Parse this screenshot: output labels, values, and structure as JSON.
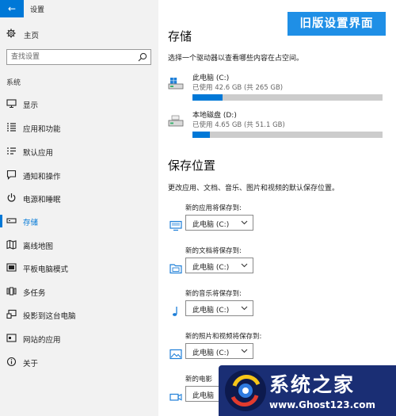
{
  "window": {
    "title": "设置",
    "back_glyph": "←"
  },
  "sidebar": {
    "home_label": "主页",
    "search_placeholder": "查找设置",
    "section_label": "系统",
    "items": [
      {
        "label": "显示",
        "icon": "display-icon"
      },
      {
        "label": "应用和功能",
        "icon": "apps-list-icon"
      },
      {
        "label": "默认应用",
        "icon": "default-apps-icon"
      },
      {
        "label": "通知和操作",
        "icon": "notification-icon"
      },
      {
        "label": "电源和睡眠",
        "icon": "power-icon"
      },
      {
        "label": "存储",
        "icon": "storage-icon",
        "active": true
      },
      {
        "label": "离线地图",
        "icon": "map-icon"
      },
      {
        "label": "平板电脑模式",
        "icon": "tablet-icon"
      },
      {
        "label": "多任务",
        "icon": "multitask-icon"
      },
      {
        "label": "投影到这台电脑",
        "icon": "project-icon"
      },
      {
        "label": "网站的应用",
        "icon": "web-apps-icon"
      },
      {
        "label": "关于",
        "icon": "info-icon"
      }
    ]
  },
  "banner": {
    "text": "旧版设置界面",
    "color": "#1f8fe6"
  },
  "storage": {
    "title": "存储",
    "description": "选择一个驱动器以查看哪些内容在占空间。",
    "drives": [
      {
        "name": "此电脑 (C:)",
        "usage": "已使用 42.6 GB (共 265 GB)",
        "used_fraction": 0.16
      },
      {
        "name": "本地磁盘 (D:)",
        "usage": "已使用 4.65 GB (共 51.1 GB)",
        "used_fraction": 0.09
      }
    ]
  },
  "save_locations": {
    "title": "保存位置",
    "description": "更改应用、文档、音乐、图片和视频的默认保存位置。",
    "rows": [
      {
        "label": "新的应用将保存到:",
        "value": "此电脑 (C:)",
        "icon": "monitor-icon"
      },
      {
        "label": "新的文档将保存到:",
        "value": "此电脑 (C:)",
        "icon": "document-folder-icon"
      },
      {
        "label": "新的音乐将保存到:",
        "value": "此电脑 (C:)",
        "icon": "music-note-icon"
      },
      {
        "label": "新的照片和视频将保存到:",
        "value": "此电脑 (C:)",
        "icon": "picture-icon"
      },
      {
        "label": "新的电影",
        "value": "此电脑",
        "icon": "video-camera-icon"
      }
    ]
  },
  "watermark": {
    "title": "系统之家",
    "url": "www.Ghost123.com"
  },
  "colors": {
    "accent": "#0078d7",
    "sidebar_bg": "#f2f2f2"
  }
}
